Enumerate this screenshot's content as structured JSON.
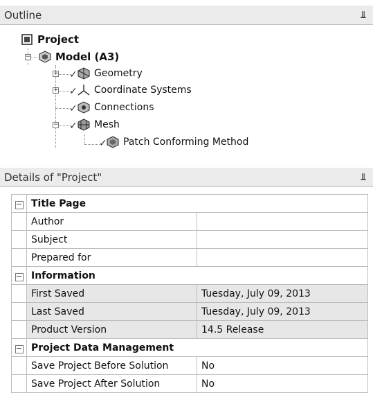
{
  "outline": {
    "title": "Outline",
    "pin": "║",
    "tree": {
      "project": "Project",
      "model": "Model (A3)",
      "geometry": "Geometry",
      "coordinate_systems": "Coordinate Systems",
      "connections": "Connections",
      "mesh": "Mesh",
      "patch_conforming": "Patch Conforming Method"
    }
  },
  "details": {
    "title": "Details of \"Project\"",
    "sections": [
      {
        "title": "Title Page",
        "rows": [
          {
            "name": "Author",
            "value": ""
          },
          {
            "name": "Subject",
            "value": ""
          },
          {
            "name": "Prepared for",
            "value": ""
          }
        ]
      },
      {
        "title": "Information",
        "rows": [
          {
            "name": "First Saved",
            "value": "Tuesday, July 09, 2013"
          },
          {
            "name": "Last Saved",
            "value": "Tuesday, July 09, 2013"
          },
          {
            "name": "Product Version",
            "value": "14.5  Release"
          }
        ]
      },
      {
        "title": "Project Data Management",
        "rows": [
          {
            "name": "Save Project Before Solution",
            "value": "No"
          },
          {
            "name": "Save Project After Solution",
            "value": "No"
          }
        ]
      }
    ]
  },
  "icons": {
    "pin": "pin-icon",
    "project": "project-icon",
    "model": "model-icon",
    "geometry": "geometry-icon",
    "coordinate_systems": "coordinate-systems-icon",
    "connections": "connections-icon",
    "mesh": "mesh-icon",
    "method": "method-icon"
  }
}
